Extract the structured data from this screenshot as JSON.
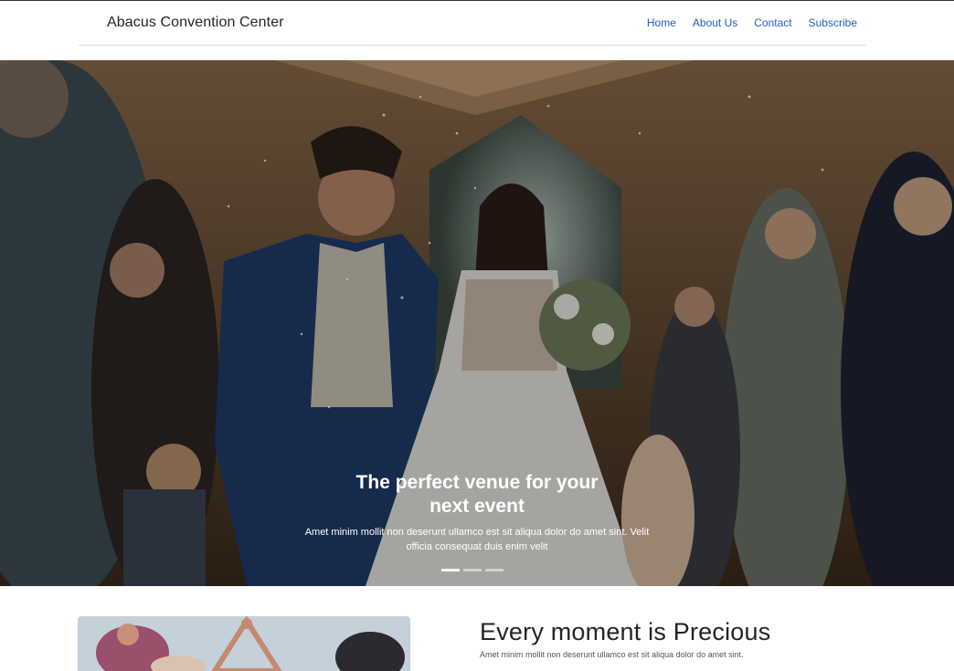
{
  "header": {
    "brand": "Abacus Convention Center",
    "nav": [
      "Home",
      "About Us",
      "Contact",
      "Subscribe"
    ]
  },
  "hero": {
    "title": "The perfect venue for your next event",
    "subtitle": "Amet minim mollit non deserunt ullamco est sit aliqua dolor do amet sint. Velit officia consequat duis enim velit",
    "slides": 3,
    "active_slide": 1
  },
  "feature": {
    "title": "Every moment is Precious",
    "text": "Amet minim mollit non deserunt ullamco est sit aliqua dolor do amet sint."
  },
  "colors": {
    "link": "#1d5fc4",
    "text": "#212529"
  }
}
